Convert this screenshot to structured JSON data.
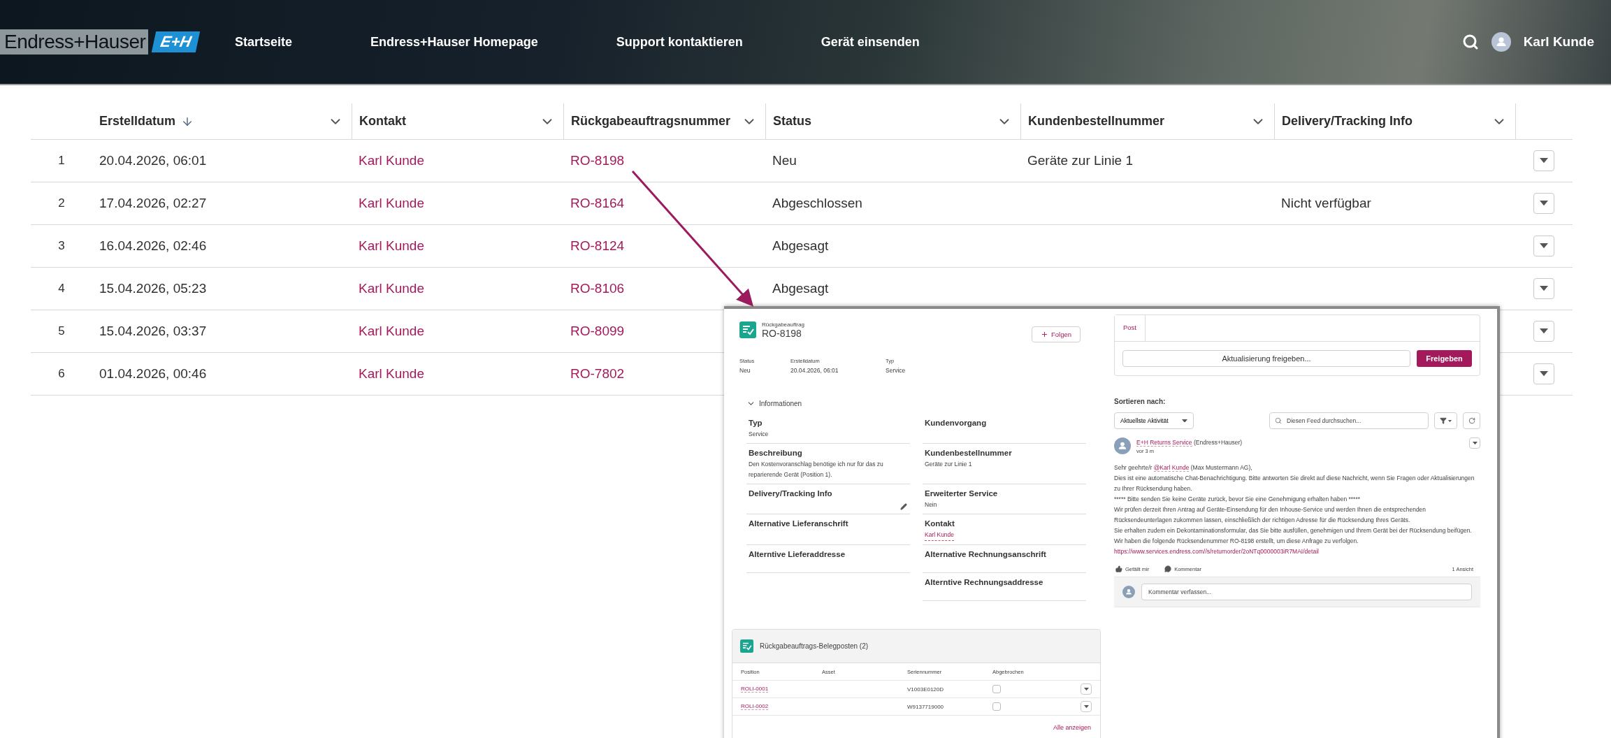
{
  "header": {
    "logo": {
      "wordmark": "Endress+Hauser",
      "badge": "E+H"
    },
    "nav": [
      {
        "label": "Startseite"
      },
      {
        "label": "Endress+Hauser Homepage"
      },
      {
        "label": "Support kontaktieren"
      },
      {
        "label": "Gerät einsenden"
      }
    ],
    "user": {
      "name": "Karl Kunde"
    }
  },
  "table": {
    "columns": [
      {
        "label": "Erstelldatum",
        "sorted": true
      },
      {
        "label": "Kontakt",
        "sorted": false
      },
      {
        "label": "Rückgabeauftragsnummer",
        "sorted": false
      },
      {
        "label": "Status",
        "sorted": false
      },
      {
        "label": "Kundenbestellnummer",
        "sorted": false
      },
      {
        "label": "Delivery/Tracking Info",
        "sorted": false
      }
    ],
    "rows": [
      {
        "number": "1",
        "date": "20.04.2026, 06:01",
        "contact": "Karl Kunde",
        "order": "RO-8198",
        "status": "Neu",
        "customer_po": "Geräte zur Linie 1"
      },
      {
        "number": "2",
        "date": "17.04.2026, 02:27",
        "contact": "Karl Kunde",
        "order": "RO-8164",
        "status": "Abgeschlossen",
        "delivery": "Nicht verfügbar"
      },
      {
        "number": "3",
        "date": "16.04.2026, 02:46",
        "contact": "Karl Kunde",
        "order": "RO-8124",
        "status": "Abgesagt"
      },
      {
        "number": "4",
        "date": "15.04.2026, 05:23",
        "contact": "Karl Kunde",
        "order": "RO-8106",
        "status": "Abgesagt"
      },
      {
        "number": "5",
        "date": "15.04.2026, 03:37",
        "contact": "Karl Kunde",
        "order": "RO-8099"
      },
      {
        "number": "6",
        "date": "01.04.2026, 00:46",
        "contact": "Karl Kunde",
        "order": "RO-7802"
      }
    ]
  },
  "detail": {
    "record_type": "Rückgabeauftrag",
    "record_name": "RO-8198",
    "follow_button": "Folgen",
    "highlights": [
      {
        "label": "Status",
        "value": "Neu"
      },
      {
        "label": "Erstelldatum",
        "value": "20.04.2026, 06:01"
      },
      {
        "label": "Typ",
        "value": "Service"
      }
    ],
    "section": {
      "title": "Informationen",
      "expanded": true
    },
    "left_fields": [
      {
        "label": "Typ",
        "value": "Service",
        "kind": "text"
      },
      {
        "label": "Beschreibung",
        "value": "Den Kostenvoranschlag benötige ich nur für das zu reparierende Gerät (Position 1).",
        "kind": "text"
      },
      {
        "label": "Delivery/Tracking Info",
        "kind": "editable"
      },
      {
        "label": "Alternative Lieferanschrift",
        "kind": "text"
      },
      {
        "label": "Alterntive Lieferaddresse",
        "kind": "text"
      }
    ],
    "right_fields": [
      {
        "label": "Kundenvorgang",
        "kind": "text"
      },
      {
        "label": "Kundenbestellnummer",
        "value": "Geräte zur Linie 1",
        "kind": "text"
      },
      {
        "label": "Erweiterter Service",
        "value": "Nein",
        "kind": "text"
      },
      {
        "label": "Kontakt",
        "value": "Karl Kunde",
        "kind": "link"
      },
      {
        "label": "Alternative Rechnungsanschrift",
        "kind": "text"
      },
      {
        "label": "Alterntive Rechnungsaddresse",
        "kind": "text"
      }
    ],
    "related_list": {
      "title": "Rückgabeauftrags-Belegposten (2)",
      "columns": [
        "Position",
        "Asset",
        "Seriennummer",
        "Abgebrochen"
      ],
      "rows": [
        {
          "position": "ROLI-0001",
          "serial": "V1003E0120D",
          "cancelled": false
        },
        {
          "position": "ROLI-0002",
          "serial": "W9137719000",
          "cancelled": false
        }
      ],
      "view_all": "Alle anzeigen"
    }
  },
  "feed": {
    "tabs": [
      {
        "label": "Post",
        "selected": true
      }
    ],
    "composer": {
      "placeholder": "Aktualisierung freigeben..."
    },
    "share_button": "Freigeben",
    "sort_label": "Sortieren nach:",
    "sort_value": "Aktuellste Aktivität",
    "search": {
      "placeholder": "Diesen Feed durchsuchen..."
    },
    "post": {
      "author": "E+H Returns Service",
      "org": "(Endress+Hauser)",
      "time": "vor 3 m",
      "greeting": {
        "before": "Sehr geehrte/r",
        "mention": "@Karl Kunde",
        "after": "(Max Mustermann AG),"
      },
      "paragraphs": [
        "Dies ist eine automatische Chat-Benachrichtigung. Bitte antworten Sie direkt auf diese Nachricht, wenn Sie Fragen oder Aktualisierungen zu Ihrer Rücksendung haben.",
        "***** Bitte senden Sie keine Geräte zurück, bevor Sie eine Genehmigung erhalten haben *****",
        "Wir prüfen derzeit Ihren Antrag auf Geräte-Einsendung für den Inhouse-Service und werden Ihnen die entsprechenden Rücksendeunterlagen zukommen lassen, einschließlich der richtigen Adresse für die Rücksendung Ihres Geräts.",
        "Sie erhalten zudem ein Dekontaminationsformular, das Sie bitte ausfüllen, genehmigen und Ihrem Gerät bei der Rücksendung beifügen. Wir haben die folgende Rücksendenummer RO-8198 erstellt, um diese Anfrage zu verfolgen."
      ],
      "link": "https://www.services.endress.com//s/returnorder/2oNTq0000003iR7MAI/detail",
      "actions": [
        {
          "label": "Gefällt mir",
          "kind": "like"
        },
        {
          "label": "Kommentar",
          "kind": "comment"
        }
      ],
      "views": "1 Ansicht"
    },
    "comment": {
      "placeholder": "Kommentar verfassen..."
    }
  }
}
